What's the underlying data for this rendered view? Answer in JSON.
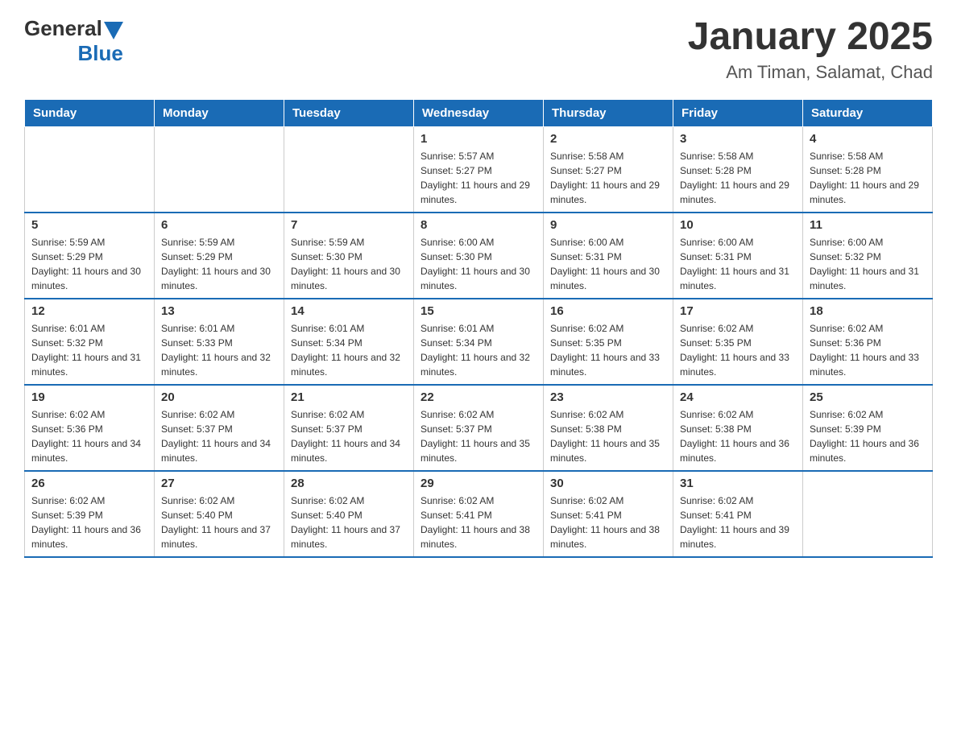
{
  "header": {
    "logo_general": "General",
    "logo_blue": "Blue",
    "month": "January 2025",
    "location": "Am Timan, Salamat, Chad"
  },
  "days_of_week": [
    "Sunday",
    "Monday",
    "Tuesday",
    "Wednesday",
    "Thursday",
    "Friday",
    "Saturday"
  ],
  "weeks": [
    [
      {
        "day": "",
        "info": ""
      },
      {
        "day": "",
        "info": ""
      },
      {
        "day": "",
        "info": ""
      },
      {
        "day": "1",
        "info": "Sunrise: 5:57 AM\nSunset: 5:27 PM\nDaylight: 11 hours and 29 minutes."
      },
      {
        "day": "2",
        "info": "Sunrise: 5:58 AM\nSunset: 5:27 PM\nDaylight: 11 hours and 29 minutes."
      },
      {
        "day": "3",
        "info": "Sunrise: 5:58 AM\nSunset: 5:28 PM\nDaylight: 11 hours and 29 minutes."
      },
      {
        "day": "4",
        "info": "Sunrise: 5:58 AM\nSunset: 5:28 PM\nDaylight: 11 hours and 29 minutes."
      }
    ],
    [
      {
        "day": "5",
        "info": "Sunrise: 5:59 AM\nSunset: 5:29 PM\nDaylight: 11 hours and 30 minutes."
      },
      {
        "day": "6",
        "info": "Sunrise: 5:59 AM\nSunset: 5:29 PM\nDaylight: 11 hours and 30 minutes."
      },
      {
        "day": "7",
        "info": "Sunrise: 5:59 AM\nSunset: 5:30 PM\nDaylight: 11 hours and 30 minutes."
      },
      {
        "day": "8",
        "info": "Sunrise: 6:00 AM\nSunset: 5:30 PM\nDaylight: 11 hours and 30 minutes."
      },
      {
        "day": "9",
        "info": "Sunrise: 6:00 AM\nSunset: 5:31 PM\nDaylight: 11 hours and 30 minutes."
      },
      {
        "day": "10",
        "info": "Sunrise: 6:00 AM\nSunset: 5:31 PM\nDaylight: 11 hours and 31 minutes."
      },
      {
        "day": "11",
        "info": "Sunrise: 6:00 AM\nSunset: 5:32 PM\nDaylight: 11 hours and 31 minutes."
      }
    ],
    [
      {
        "day": "12",
        "info": "Sunrise: 6:01 AM\nSunset: 5:32 PM\nDaylight: 11 hours and 31 minutes."
      },
      {
        "day": "13",
        "info": "Sunrise: 6:01 AM\nSunset: 5:33 PM\nDaylight: 11 hours and 32 minutes."
      },
      {
        "day": "14",
        "info": "Sunrise: 6:01 AM\nSunset: 5:34 PM\nDaylight: 11 hours and 32 minutes."
      },
      {
        "day": "15",
        "info": "Sunrise: 6:01 AM\nSunset: 5:34 PM\nDaylight: 11 hours and 32 minutes."
      },
      {
        "day": "16",
        "info": "Sunrise: 6:02 AM\nSunset: 5:35 PM\nDaylight: 11 hours and 33 minutes."
      },
      {
        "day": "17",
        "info": "Sunrise: 6:02 AM\nSunset: 5:35 PM\nDaylight: 11 hours and 33 minutes."
      },
      {
        "day": "18",
        "info": "Sunrise: 6:02 AM\nSunset: 5:36 PM\nDaylight: 11 hours and 33 minutes."
      }
    ],
    [
      {
        "day": "19",
        "info": "Sunrise: 6:02 AM\nSunset: 5:36 PM\nDaylight: 11 hours and 34 minutes."
      },
      {
        "day": "20",
        "info": "Sunrise: 6:02 AM\nSunset: 5:37 PM\nDaylight: 11 hours and 34 minutes."
      },
      {
        "day": "21",
        "info": "Sunrise: 6:02 AM\nSunset: 5:37 PM\nDaylight: 11 hours and 34 minutes."
      },
      {
        "day": "22",
        "info": "Sunrise: 6:02 AM\nSunset: 5:37 PM\nDaylight: 11 hours and 35 minutes."
      },
      {
        "day": "23",
        "info": "Sunrise: 6:02 AM\nSunset: 5:38 PM\nDaylight: 11 hours and 35 minutes."
      },
      {
        "day": "24",
        "info": "Sunrise: 6:02 AM\nSunset: 5:38 PM\nDaylight: 11 hours and 36 minutes."
      },
      {
        "day": "25",
        "info": "Sunrise: 6:02 AM\nSunset: 5:39 PM\nDaylight: 11 hours and 36 minutes."
      }
    ],
    [
      {
        "day": "26",
        "info": "Sunrise: 6:02 AM\nSunset: 5:39 PM\nDaylight: 11 hours and 36 minutes."
      },
      {
        "day": "27",
        "info": "Sunrise: 6:02 AM\nSunset: 5:40 PM\nDaylight: 11 hours and 37 minutes."
      },
      {
        "day": "28",
        "info": "Sunrise: 6:02 AM\nSunset: 5:40 PM\nDaylight: 11 hours and 37 minutes."
      },
      {
        "day": "29",
        "info": "Sunrise: 6:02 AM\nSunset: 5:41 PM\nDaylight: 11 hours and 38 minutes."
      },
      {
        "day": "30",
        "info": "Sunrise: 6:02 AM\nSunset: 5:41 PM\nDaylight: 11 hours and 38 minutes."
      },
      {
        "day": "31",
        "info": "Sunrise: 6:02 AM\nSunset: 5:41 PM\nDaylight: 11 hours and 39 minutes."
      },
      {
        "day": "",
        "info": ""
      }
    ]
  ]
}
